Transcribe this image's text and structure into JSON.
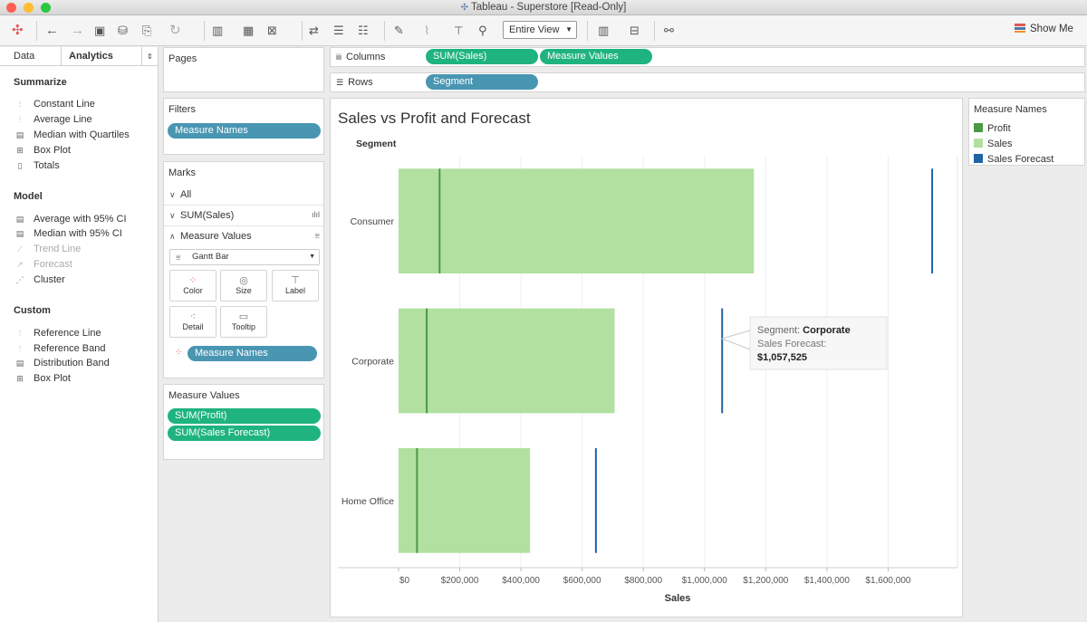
{
  "window": {
    "title": "Tableau - Superstore [Read-Only]",
    "traffic_colors": [
      "#fe5f57",
      "#febc2e",
      "#28c840"
    ]
  },
  "toolbar": {
    "fit_select": "Entire View",
    "show_me": "Show Me",
    "icons": [
      "tableau-logo-icon",
      "back-arrow-icon",
      "forward-arrow-icon",
      "save-icon",
      "new-datasource-icon",
      "paste-icon",
      "refresh-icon",
      "new-worksheet-icon",
      "duplicate-icon",
      "clear-sheet-icon",
      "swap-icon",
      "sort-ascending-icon",
      "sort-descending-icon",
      "highlight-icon",
      "group-icon",
      "label-icon",
      "pin-icon",
      "bar-chart-icon",
      "presentation-icon",
      "share-icon"
    ]
  },
  "left_panel": {
    "tabs": [
      "Data",
      "Analytics"
    ],
    "sections": [
      {
        "title": "Summarize",
        "items": [
          {
            "label": "Constant Line",
            "enabled": true
          },
          {
            "label": "Average Line",
            "enabled": true
          },
          {
            "label": "Median with Quartiles",
            "enabled": true
          },
          {
            "label": "Box Plot",
            "enabled": true
          },
          {
            "label": "Totals",
            "enabled": true
          }
        ]
      },
      {
        "title": "Model",
        "items": [
          {
            "label": "Average with 95% CI",
            "enabled": true
          },
          {
            "label": "Median with 95% CI",
            "enabled": true
          },
          {
            "label": "Trend Line",
            "enabled": false
          },
          {
            "label": "Forecast",
            "enabled": false
          },
          {
            "label": "Cluster",
            "enabled": true
          }
        ]
      },
      {
        "title": "Custom",
        "items": [
          {
            "label": "Reference Line",
            "enabled": true
          },
          {
            "label": "Reference Band",
            "enabled": true
          },
          {
            "label": "Distribution Band",
            "enabled": true
          },
          {
            "label": "Box Plot",
            "enabled": true
          }
        ]
      }
    ]
  },
  "pages": {
    "title": "Pages"
  },
  "filters": {
    "title": "Filters",
    "pills": [
      "Measure Names"
    ]
  },
  "marks": {
    "title": "Marks",
    "rows": [
      "All",
      "SUM(Sales)",
      "Measure Values"
    ],
    "mark_type": "Gantt Bar",
    "buttons": [
      "Color",
      "Size",
      "Label",
      "Detail",
      "Tooltip"
    ],
    "color_pill": "Measure Names"
  },
  "measure_values": {
    "title": "Measure Values",
    "pills": [
      "SUM(Profit)",
      "SUM(Sales Forecast)"
    ]
  },
  "shelves": {
    "columns_label": "Columns",
    "columns_pills": [
      "SUM(Sales)",
      "Measure Values"
    ],
    "rows_label": "Rows",
    "rows_pills": [
      "Segment"
    ]
  },
  "legend": {
    "title": "Measure Names",
    "items": [
      {
        "label": "Profit",
        "color": "#4b9a46"
      },
      {
        "label": "Sales",
        "color": "#b1e0a0"
      },
      {
        "label": "Sales Forecast",
        "color": "#1f63a6"
      }
    ]
  },
  "tooltip": {
    "segment_label": "Segment:",
    "segment_value": "Corporate",
    "forecast_label": "Sales Forecast:",
    "forecast_value": "$1,057,525"
  },
  "chart_data": {
    "type": "bar",
    "title": "Sales vs Profit and Forecast",
    "row_header": "Segment",
    "xlabel": "Sales",
    "categories": [
      "Consumer",
      "Corporate",
      "Home Office"
    ],
    "xlim": [
      0,
      1800000
    ],
    "x_ticks": [
      0,
      200000,
      400000,
      600000,
      800000,
      1000000,
      1200000,
      1400000,
      1600000
    ],
    "x_tick_labels": [
      "$0",
      "$200,000",
      "$400,000",
      "$600,000",
      "$800,000",
      "$1,000,000",
      "$1,200,000",
      "$1,400,000",
      "$1,600,000"
    ],
    "series": [
      {
        "name": "Sales",
        "values": [
          1161401,
          706146,
          429653
        ]
      },
      {
        "name": "Profit",
        "values": [
          134119,
          91979,
          60299
        ]
      },
      {
        "name": "Sales Forecast",
        "values": [
          1744000,
          1057525,
          645000
        ]
      }
    ]
  }
}
